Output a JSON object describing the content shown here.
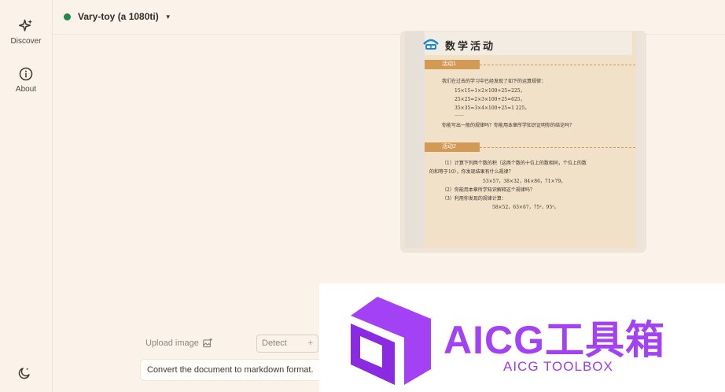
{
  "sidebar": {
    "items": [
      {
        "label": "Discover",
        "icon": "sparkle-icon"
      },
      {
        "label": "About",
        "icon": "info-icon"
      }
    ],
    "theme_icon": "moon-icon"
  },
  "header": {
    "model_name": "Vary-toy (a 1080ti)",
    "status_color": "#1f8a4a"
  },
  "document": {
    "title": "数学活动",
    "section1": "活动1",
    "section1_lines": [
      "我们在过去的学习中已经发现了如下的运算规律：",
      "15×15=1×2×100+25=225，",
      "25×25=2×3×100+25=625，",
      "35×35=3×4×100+25=1 225，",
      "……",
      "你能写出一般的规律吗？你能用本章所学知识证明你的结论吗？"
    ],
    "section2": "活动2",
    "section2_lines": [
      "（1）计算下列两个数的积（这两个数的十位上的数相同，个位上的数",
      "的和等于10），你发现结果有什么规律？",
      "53×57，38×32，84×86，71×79。",
      "（2）你能用本章所学知识解释这个规律吗？",
      "（3）利用你发现的规律计算：",
      "58×52，63×67，75²，95²。"
    ]
  },
  "controls": {
    "upload_label": "Upload image",
    "detect_label": "Detect",
    "detect_plus": "+",
    "prompt_value": "Convert the document to markdown format."
  },
  "watermark": {
    "title": "AICG工具箱",
    "subtitle": "AICG TOOLBOX",
    "color": "#a341f4"
  }
}
